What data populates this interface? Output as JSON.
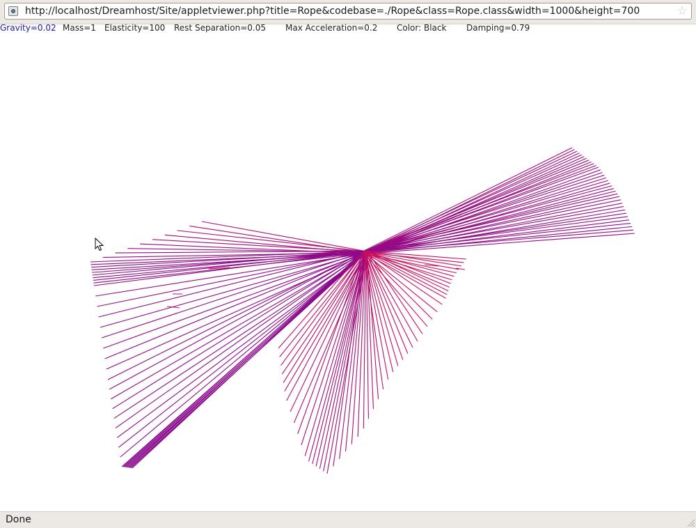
{
  "browser": {
    "url": "http://localhost/Dreamhost/Site/appletviewer.php?title=Rope&codebase=./Rope&class=Rope.class&width=1000&height=700",
    "status": "Done"
  },
  "params": [
    {
      "text": "Gravity=0.02",
      "color": "#1a1aa6"
    },
    {
      "text": "Mass=1",
      "color": "#222222"
    },
    {
      "text": "Elasticity=100",
      "color": "#222222"
    },
    {
      "text": "Rest Separation=0.05",
      "color": "#222222"
    },
    {
      "text": "Max Acceleration=0.2",
      "color": "#222222"
    },
    {
      "text": "Color: Black",
      "color": "#222222"
    },
    {
      "text": "Damping=0.79",
      "color": "#222222"
    }
  ],
  "rope_colors": {
    "start": "#e8114a",
    "end": "#8a0a8c"
  }
}
